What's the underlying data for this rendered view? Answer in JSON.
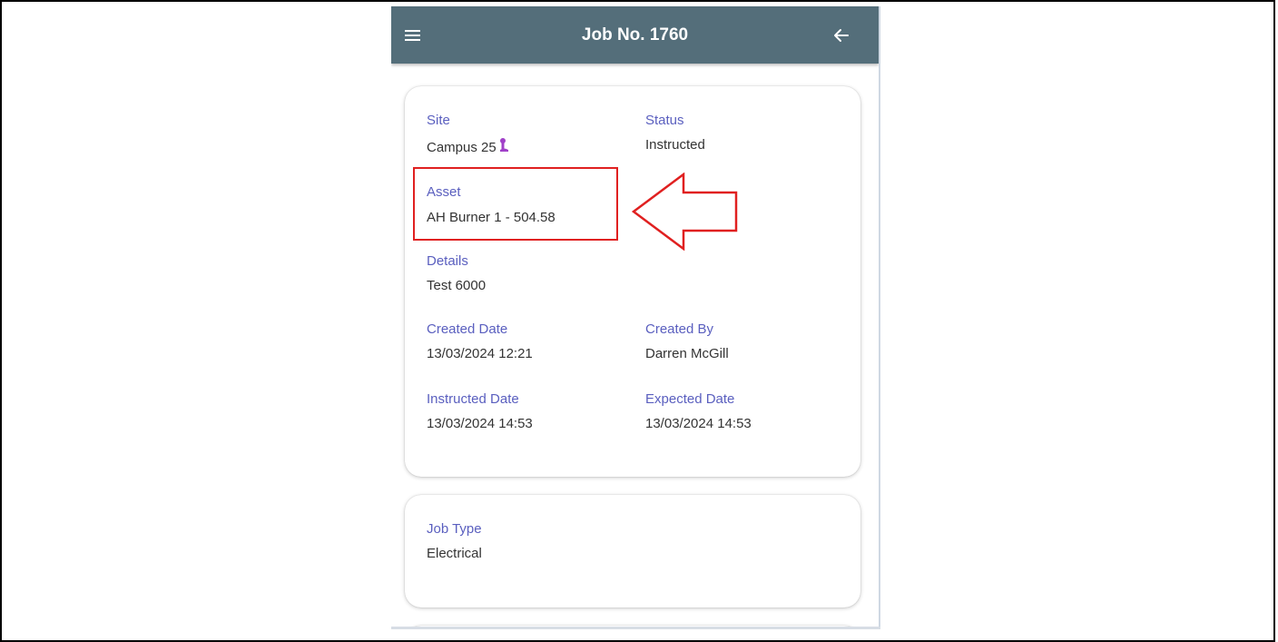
{
  "header": {
    "title": "Job No. 1760",
    "menu_icon": "hamburger-menu-icon",
    "back_icon": "arrow-left-icon",
    "background_color": "#546e7a"
  },
  "details_card": {
    "site_label": "Site",
    "site_value": "Campus 25",
    "site_icon": "map-pin-icon",
    "status_label": "Status",
    "status_value": "Instructed",
    "asset_label": "Asset",
    "asset_value": "AH Burner 1 - 504.58",
    "details_label": "Details",
    "details_value": "Test 6000",
    "created_date_label": "Created Date",
    "created_date_value": "13/03/2024 12:21",
    "created_by_label": "Created By",
    "created_by_value": "Darren McGill",
    "instructed_date_label": "Instructed Date",
    "instructed_date_value": "13/03/2024 14:53",
    "expected_date_label": "Expected Date",
    "expected_date_value": "13/03/2024 14:53"
  },
  "job_type_card": {
    "label": "Job Type",
    "value": "Electrical"
  },
  "annotation": {
    "highlight_color": "#e02020",
    "arrow_icon": "left-arrow-outline-icon"
  },
  "colors": {
    "label_color": "#5a5fbf",
    "value_color": "#333333",
    "pin_color": "#a040c8"
  }
}
